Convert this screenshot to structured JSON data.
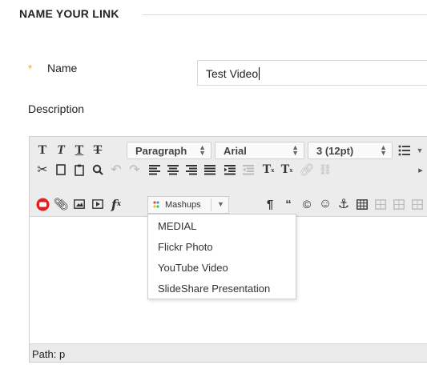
{
  "section": {
    "title": "NAME YOUR LINK"
  },
  "name_field": {
    "required_mark": "*",
    "label": "Name",
    "value": "Test Video"
  },
  "description": {
    "label": "Description"
  },
  "toolbar": {
    "paragraph_select": "Paragraph",
    "font_select": "Arial",
    "size_select": "3 (12pt)",
    "mashups_label": "Mashups",
    "row1_glyphs": [
      "T",
      "T",
      "T",
      "T"
    ],
    "row2_glyphs": [
      "T",
      "T"
    ],
    "fx_glyph": "f",
    "fx_sub": "x"
  },
  "mashups_menu": {
    "items": [
      "MEDIAL",
      "Flickr Photo",
      "YouTube Video",
      "SlideShare Presentation"
    ]
  },
  "status_bar": {
    "path": "Path: p"
  },
  "colors": {
    "accent_required": "#f0a030",
    "toolbar_bg": "#ececec",
    "youtube_red": "#e02020"
  }
}
